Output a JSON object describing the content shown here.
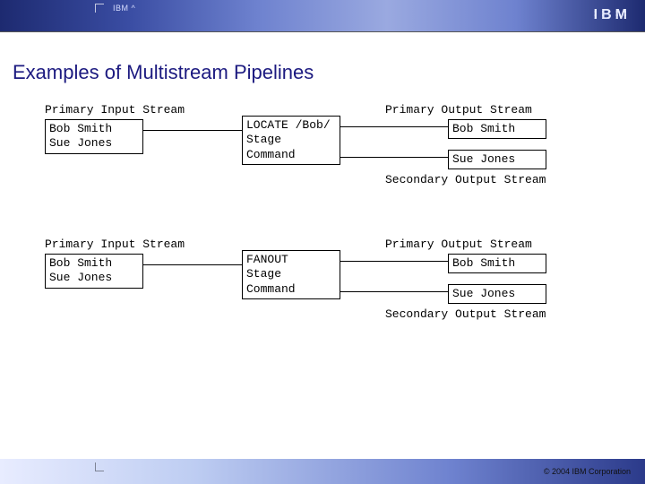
{
  "header": {
    "brand": "IBM ^",
    "logo": "IBM"
  },
  "title": "Examples of Multistream Pipelines",
  "diagram1": {
    "primary_in_label": "Primary Input Stream",
    "input_rows": [
      "Bob Smith",
      "Sue Jones"
    ],
    "stage_lines": [
      "LOCATE /Bob/",
      "Stage",
      "Command"
    ],
    "primary_out_label": "Primary Output Stream",
    "primary_out_rows": [
      "Bob Smith"
    ],
    "secondary_out_rows": [
      "Sue Jones"
    ],
    "secondary_out_label": "Secondary Output Stream"
  },
  "diagram2": {
    "primary_in_label": "Primary Input Stream",
    "input_rows": [
      "Bob Smith",
      "Sue Jones"
    ],
    "stage_lines": [
      "FANOUT",
      "Stage",
      "Command"
    ],
    "primary_out_label": "Primary Output Stream",
    "primary_out_rows": [
      "Bob Smith"
    ],
    "secondary_out_rows": [
      "Sue Jones"
    ],
    "secondary_out_label": "Secondary Output Stream"
  },
  "footer": {
    "copyright": "© 2004 IBM Corporation"
  }
}
